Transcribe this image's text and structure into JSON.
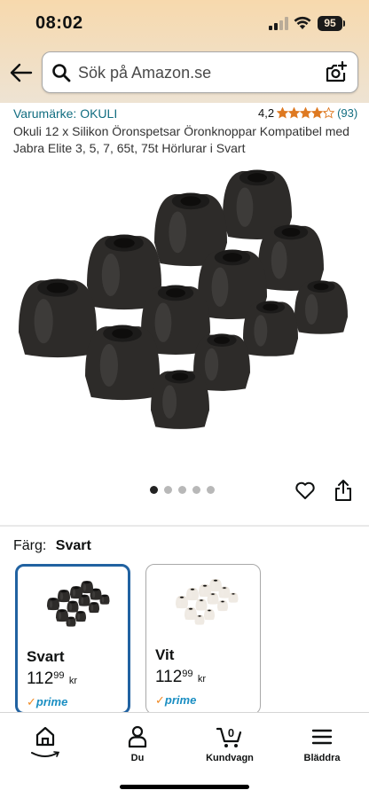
{
  "status_bar": {
    "time": "08:02",
    "battery": "95"
  },
  "search": {
    "placeholder": "Sök på Amazon.se"
  },
  "product": {
    "brand": "Varumärke: OKULI",
    "rating": "4,2",
    "rating_count": "(93)",
    "title": "Okuli 12 x Silikon Öronspetsar Öronknoppar Kompatibel med Jabra Elite 3, 5, 7, 65t, 75t Hörlurar i Svart",
    "image_count": 5,
    "active_image_index": 0
  },
  "color": {
    "label": "Färg:",
    "selected": "Svart"
  },
  "variants": [
    {
      "name": "Svart",
      "price_whole": "112",
      "price_fraction": "99",
      "currency": "kr",
      "prime": "prime",
      "selected": true,
      "color": "#2d2b29"
    },
    {
      "name": "Vit",
      "price_whole": "112",
      "price_fraction": "99",
      "currency": "kr",
      "prime": "prime",
      "selected": false,
      "color": "#efeae3"
    }
  ],
  "bottom_nav": {
    "home_label": "",
    "account_label": "Du",
    "cart_label": "Kundvagn",
    "cart_count": "0",
    "menu_label": "Bläddra"
  },
  "colors": {
    "link": "#116d80",
    "star": "#de7921",
    "prime": "#1a8ec2",
    "selected_border": "#2162a1"
  }
}
